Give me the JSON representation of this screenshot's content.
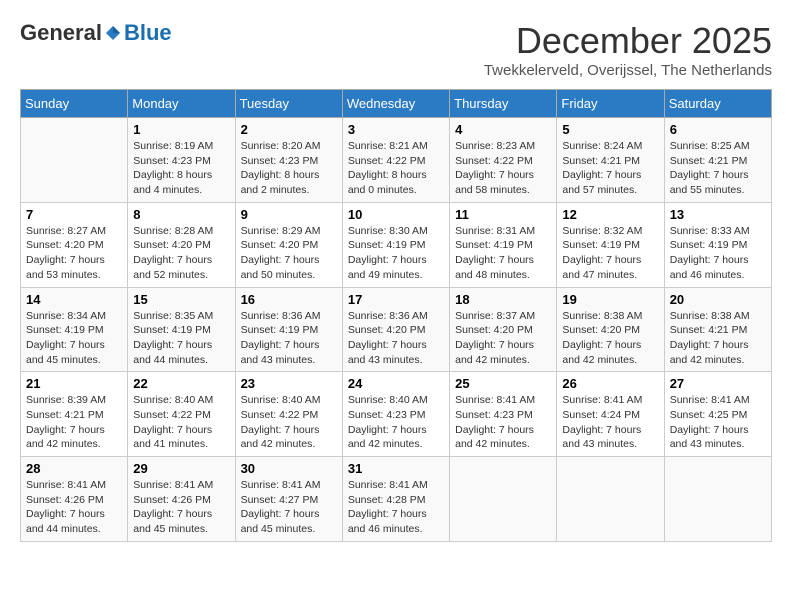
{
  "header": {
    "logo_general": "General",
    "logo_blue": "Blue",
    "month": "December 2025",
    "location": "Twekkelerveld, Overijssel, The Netherlands"
  },
  "days_of_week": [
    "Sunday",
    "Monday",
    "Tuesday",
    "Wednesday",
    "Thursday",
    "Friday",
    "Saturday"
  ],
  "weeks": [
    [
      {
        "day": "",
        "info": ""
      },
      {
        "day": "1",
        "info": "Sunrise: 8:19 AM\nSunset: 4:23 PM\nDaylight: 8 hours\nand 4 minutes."
      },
      {
        "day": "2",
        "info": "Sunrise: 8:20 AM\nSunset: 4:23 PM\nDaylight: 8 hours\nand 2 minutes."
      },
      {
        "day": "3",
        "info": "Sunrise: 8:21 AM\nSunset: 4:22 PM\nDaylight: 8 hours\nand 0 minutes."
      },
      {
        "day": "4",
        "info": "Sunrise: 8:23 AM\nSunset: 4:22 PM\nDaylight: 7 hours\nand 58 minutes."
      },
      {
        "day": "5",
        "info": "Sunrise: 8:24 AM\nSunset: 4:21 PM\nDaylight: 7 hours\nand 57 minutes."
      },
      {
        "day": "6",
        "info": "Sunrise: 8:25 AM\nSunset: 4:21 PM\nDaylight: 7 hours\nand 55 minutes."
      }
    ],
    [
      {
        "day": "7",
        "info": "Sunrise: 8:27 AM\nSunset: 4:20 PM\nDaylight: 7 hours\nand 53 minutes."
      },
      {
        "day": "8",
        "info": "Sunrise: 8:28 AM\nSunset: 4:20 PM\nDaylight: 7 hours\nand 52 minutes."
      },
      {
        "day": "9",
        "info": "Sunrise: 8:29 AM\nSunset: 4:20 PM\nDaylight: 7 hours\nand 50 minutes."
      },
      {
        "day": "10",
        "info": "Sunrise: 8:30 AM\nSunset: 4:19 PM\nDaylight: 7 hours\nand 49 minutes."
      },
      {
        "day": "11",
        "info": "Sunrise: 8:31 AM\nSunset: 4:19 PM\nDaylight: 7 hours\nand 48 minutes."
      },
      {
        "day": "12",
        "info": "Sunrise: 8:32 AM\nSunset: 4:19 PM\nDaylight: 7 hours\nand 47 minutes."
      },
      {
        "day": "13",
        "info": "Sunrise: 8:33 AM\nSunset: 4:19 PM\nDaylight: 7 hours\nand 46 minutes."
      }
    ],
    [
      {
        "day": "14",
        "info": "Sunrise: 8:34 AM\nSunset: 4:19 PM\nDaylight: 7 hours\nand 45 minutes."
      },
      {
        "day": "15",
        "info": "Sunrise: 8:35 AM\nSunset: 4:19 PM\nDaylight: 7 hours\nand 44 minutes."
      },
      {
        "day": "16",
        "info": "Sunrise: 8:36 AM\nSunset: 4:19 PM\nDaylight: 7 hours\nand 43 minutes."
      },
      {
        "day": "17",
        "info": "Sunrise: 8:36 AM\nSunset: 4:20 PM\nDaylight: 7 hours\nand 43 minutes."
      },
      {
        "day": "18",
        "info": "Sunrise: 8:37 AM\nSunset: 4:20 PM\nDaylight: 7 hours\nand 42 minutes."
      },
      {
        "day": "19",
        "info": "Sunrise: 8:38 AM\nSunset: 4:20 PM\nDaylight: 7 hours\nand 42 minutes."
      },
      {
        "day": "20",
        "info": "Sunrise: 8:38 AM\nSunset: 4:21 PM\nDaylight: 7 hours\nand 42 minutes."
      }
    ],
    [
      {
        "day": "21",
        "info": "Sunrise: 8:39 AM\nSunset: 4:21 PM\nDaylight: 7 hours\nand 42 minutes."
      },
      {
        "day": "22",
        "info": "Sunrise: 8:40 AM\nSunset: 4:22 PM\nDaylight: 7 hours\nand 41 minutes."
      },
      {
        "day": "23",
        "info": "Sunrise: 8:40 AM\nSunset: 4:22 PM\nDaylight: 7 hours\nand 42 minutes."
      },
      {
        "day": "24",
        "info": "Sunrise: 8:40 AM\nSunset: 4:23 PM\nDaylight: 7 hours\nand 42 minutes."
      },
      {
        "day": "25",
        "info": "Sunrise: 8:41 AM\nSunset: 4:23 PM\nDaylight: 7 hours\nand 42 minutes."
      },
      {
        "day": "26",
        "info": "Sunrise: 8:41 AM\nSunset: 4:24 PM\nDaylight: 7 hours\nand 43 minutes."
      },
      {
        "day": "27",
        "info": "Sunrise: 8:41 AM\nSunset: 4:25 PM\nDaylight: 7 hours\nand 43 minutes."
      }
    ],
    [
      {
        "day": "28",
        "info": "Sunrise: 8:41 AM\nSunset: 4:26 PM\nDaylight: 7 hours\nand 44 minutes."
      },
      {
        "day": "29",
        "info": "Sunrise: 8:41 AM\nSunset: 4:26 PM\nDaylight: 7 hours\nand 45 minutes."
      },
      {
        "day": "30",
        "info": "Sunrise: 8:41 AM\nSunset: 4:27 PM\nDaylight: 7 hours\nand 45 minutes."
      },
      {
        "day": "31",
        "info": "Sunrise: 8:41 AM\nSunset: 4:28 PM\nDaylight: 7 hours\nand 46 minutes."
      },
      {
        "day": "",
        "info": ""
      },
      {
        "day": "",
        "info": ""
      },
      {
        "day": "",
        "info": ""
      }
    ]
  ]
}
